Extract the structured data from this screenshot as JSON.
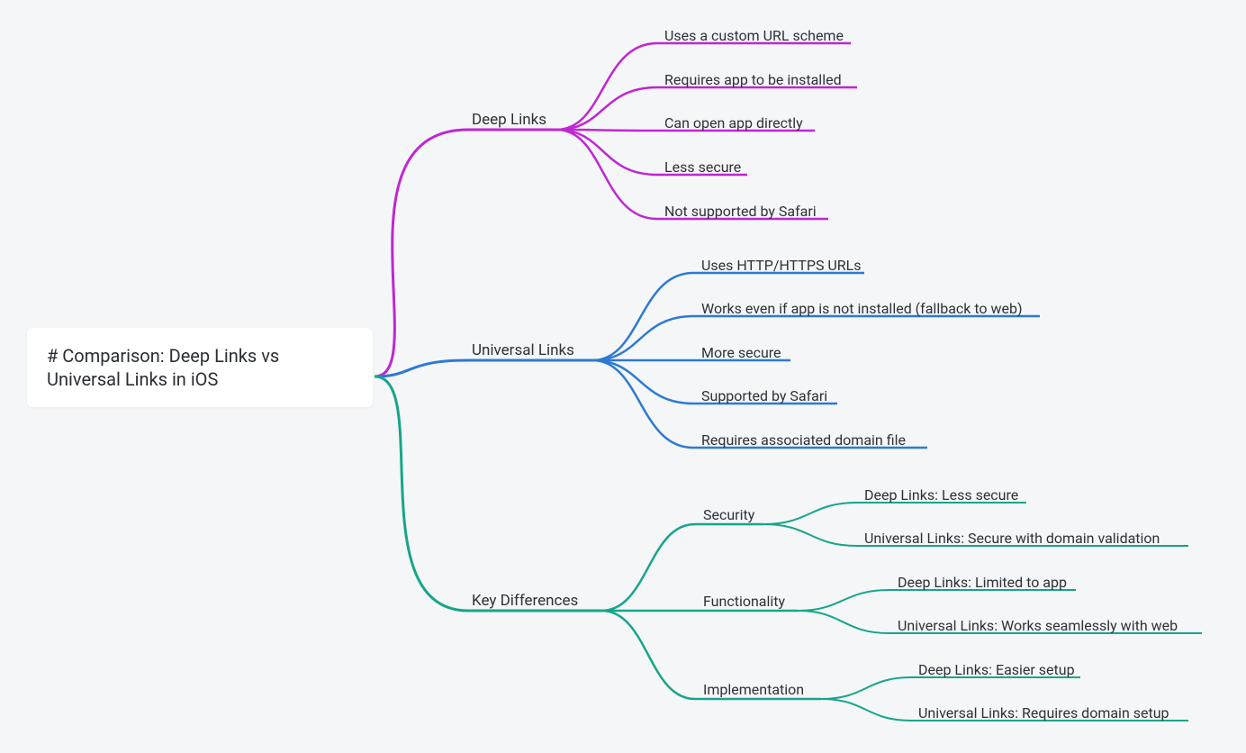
{
  "colors": {
    "magenta": "#c026d3",
    "blue": "#2d7ad1",
    "teal": "#17a589"
  },
  "root": {
    "title": "# Comparison: Deep Links vs Universal Links in iOS"
  },
  "branches": {
    "deep": {
      "label": "Deep Links",
      "items": [
        "Uses a custom URL scheme",
        "Requires app to be installed",
        "Can open app directly",
        "Less secure",
        "Not supported by Safari"
      ]
    },
    "universal": {
      "label": "Universal Links",
      "items": [
        "Uses HTTP/HTTPS URLs",
        "Works even if app is not installed (fallback to web)",
        "More secure",
        "Supported by Safari",
        "Requires associated domain file"
      ]
    },
    "keydiff": {
      "label": "Key Differences",
      "subs": {
        "security": {
          "label": "Security",
          "items": [
            "Deep Links: Less secure",
            "Universal Links: Secure with domain validation"
          ]
        },
        "functionality": {
          "label": "Functionality",
          "items": [
            "Deep Links: Limited to app",
            "Universal Links: Works seamlessly with web"
          ]
        },
        "implementation": {
          "label": "Implementation",
          "items": [
            "Deep Links: Easier setup",
            "Universal Links: Requires domain setup"
          ]
        }
      }
    }
  }
}
